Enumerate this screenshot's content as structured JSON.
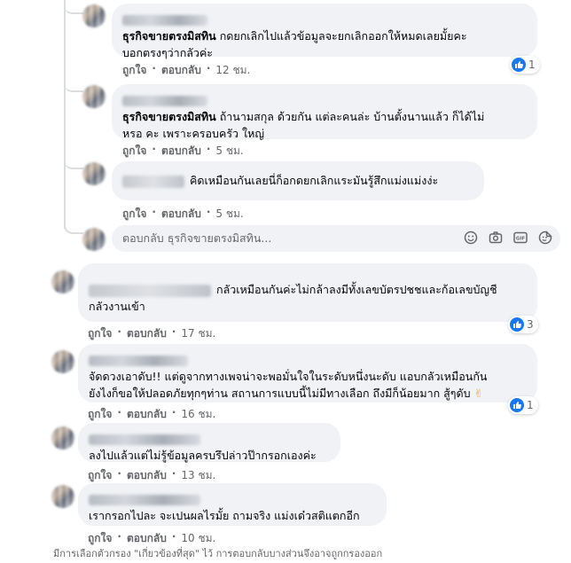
{
  "comments": [
    {
      "id": "r1",
      "author": "ธุรกิจขายตรงมิสทิน",
      "text": "กดยกเลิกไปแล้วข้อมูลจะยกเลิกออกให้หมดเลยมั้ยคะ",
      "text2": "บอกตรงๆว่ากลัวค่ะ",
      "like": "ถูกใจ",
      "reply": "ตอบกลับ",
      "time": "12 ชม.",
      "reactions": "1"
    },
    {
      "id": "r2",
      "author": "ธุรกิจขายตรงมิสทิน",
      "text": "ถ้านามสกุล ด้วยกัน แต่ละคนล่ะ บ้านตั้งนานแล้ว ก็ได้ไม่",
      "text2": "หรอ คะ เพราะครอบครัว ใหญ่",
      "like": "ถูกใจ",
      "reply": "ตอบกลับ",
      "time": "5 ชม."
    },
    {
      "id": "r3",
      "text": "คิดเหมือนกันเลยนี่ก็อกดยกเลิกแระมันรู้สึกแม่งแม่งง่ะ",
      "like": "ถูกใจ",
      "reply": "ตอบกลับ",
      "time": "5 ชม."
    },
    {
      "id": "c1",
      "text": "กลัวเหมือนกันค่ะไม่กล้าลงมีทั้งเลขบัตรปชชและก้อเลขบัญชี",
      "text2": "กลัวงานเข้า",
      "like": "ถูกใจ",
      "reply": "ตอบกลับ",
      "time": "17 ชม.",
      "reactions": "3"
    },
    {
      "id": "c2",
      "text": "จัดดวงเอาดับ!! แต่ดูจากทางเพจน่าจะพอมั่นใจในระดับหนึ่งนะดับ แอบกลัวเหมือนกัน",
      "text2": "ยังไงก็ขอให้ปลอดภัยทุกๆท่าน สถานการแบบนี้ไม่มีทางเลือก ถึงมีก็น้อยมาก สู้ๆดับ",
      "emoji": "✌",
      "like": "ถูกใจ",
      "reply": "ตอบกลับ",
      "time": "16 ชม.",
      "reactions": "1"
    },
    {
      "id": "c3",
      "text": "ลงไปแล้วแต่ไม่รู้ข้อมูลครบรึปล่าวป๊ากรอกเองค่ะ",
      "like": "ถูกใจ",
      "reply": "ตอบกลับ",
      "time": "13 ชม."
    },
    {
      "id": "c4",
      "text": "เรากรอกไปละ จะเปนผลไรมั้ย ถามจริง แม่งเด๋วสติแตกอีก",
      "like": "ถูกใจ",
      "reply": "ตอบกลับ",
      "time": "10 ชม."
    }
  ],
  "reply_box": {
    "placeholder": "ตอบกลับ ธุรกิจขายตรงมิสทิน..."
  },
  "icons": [
    "emoji-icon",
    "camera-icon",
    "gif-icon",
    "sticker-icon"
  ],
  "footer": "มีการเลือกตัวกรอง \"เกี่ยวข้องที่สุด\" ไว้ การตอบกลับบางส่วนจึงอาจถูกกรองออก",
  "colors": {
    "accent": "#1877f2",
    "bubble": "#f0f2f5",
    "meta": "#65676b"
  }
}
